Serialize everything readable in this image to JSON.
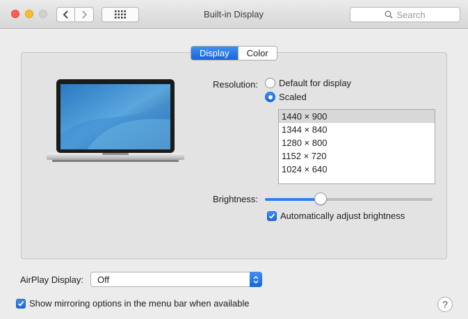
{
  "window": {
    "title": "Built-in Display",
    "search_placeholder": "Search"
  },
  "tabs": [
    {
      "label": "Display",
      "active": true
    },
    {
      "label": "Color",
      "active": false
    }
  ],
  "resolution": {
    "label": "Resolution:",
    "options": [
      {
        "label": "Default for display",
        "selected": false
      },
      {
        "label": "Scaled",
        "selected": true
      }
    ],
    "scaled_list": [
      "1440 × 900",
      "1344 × 840",
      "1280 × 800",
      "1152 × 720",
      "1024 × 640"
    ],
    "selected_index": 0
  },
  "brightness": {
    "label": "Brightness:",
    "level": 0.33,
    "auto_label": "Automatically adjust brightness",
    "auto_checked": true
  },
  "airplay": {
    "label": "AirPlay Display:",
    "value": "Off"
  },
  "mirroring": {
    "label": "Show mirroring options in the menu bar when available",
    "checked": true
  },
  "help": "?",
  "colors": {
    "accent": "#1865d6",
    "close": "#fc5f57",
    "minimize": "#fdbc2e"
  }
}
